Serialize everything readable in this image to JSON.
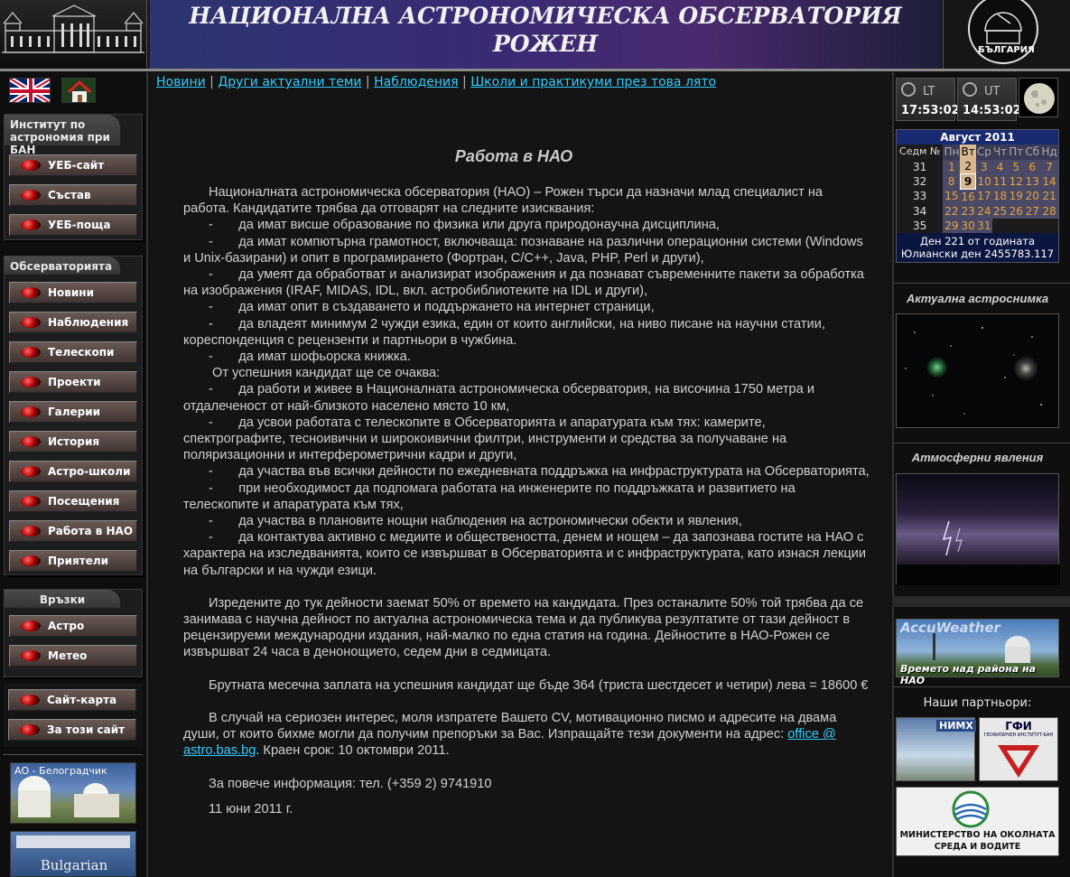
{
  "header": {
    "title_line1": "НАЦИОНАЛНА АСТРОНОМИЧЕСКА ОБСЕРВАТОРИЯ",
    "title_line2": "РОЖЕН",
    "logo_text": "БЪЛГАРИЯ"
  },
  "left": {
    "institute_title": "Институт по астрономия при БАН",
    "institute_items": [
      "УЕБ-сайт",
      "Състав",
      "УЕБ-поща"
    ],
    "observatory_title": "Обсерваторията",
    "observatory_items": [
      "Новини",
      "Наблюдения",
      "Телескопи",
      "Проекти",
      "Галерии",
      "История",
      "Астро-школи",
      "Посещения",
      "Работа в НАО",
      "Приятели"
    ],
    "links_title": "Връзки",
    "links_items": [
      "Астро",
      "Метео"
    ],
    "extra_items": [
      "Сайт-карта",
      "За този сайт"
    ],
    "thumb1_caption": "АО - Белоградчик",
    "thumb2_caption": "Bulgarian"
  },
  "topnav": {
    "items": [
      "Новини",
      "Други актуални теми",
      "Наблюдения",
      "Школи и практикуми през това лято"
    ],
    "separator": " | "
  },
  "content": {
    "title": "Работа в НАО",
    "p1": "Националната астрономическа обсерватория (НАО) – Рожен търси да назначи млад специалист на работа.  Кандидатите трябва да отговарят на следните изисквания:",
    "req": [
      "да имат висше образование по физика или друга природонаучна дисциплина,",
      "да имат компютърна грамотност, включваща: познаване на различни операционни системи (Windows и Unix-базирани) и опит в програмирането (Фортран, C/C++, Java, PHP, Perl и други),",
      "да умеят да обработват и анализират изображения и да познават съвременните пакети за обработка на изображения (IRAF, MIDAS, IDL, вкл. астробиблиотеките на IDL и други),",
      "да имат опит в създаването и  поддържането на интернет страници,",
      "да владеят минимум 2 чужди езика, един от които английски, на ниво писане на научни статии, кореспонденция с рецензенти и партньори в чужбина.",
      "да имат шофьорска книжка."
    ],
    "expect_intro": "От успешния кандидат ще се очаква:",
    "exp": [
      "да работи и живее в Националната астрономическа обсерватория, на височина 1750 метра и отдалеченост от най-близкото населено място 10 км,",
      "да усвои работата с телескопите в Обсерваторията и апаратурата към тях: камерите, спектрографите, тесноивични и широкоивични филтри, инструменти и средства за получаване на поляризационни и интерферометрични кадри и други,",
      "да участва във всички дейности по ежедневната поддръжка на инфраструктурата на Обсерваторията,",
      "при необходимост да подпомага работата на инженерите по поддръжката и развитието на телескопите и апаратурата към тях,",
      "да участва в плановите нощни наблюдения на астрономически обекти и явления,",
      "да контактува активно с медиите и обществеността, денем и нощем – да запознава гостите на НАО с характера на изследванията, които се извършват в Обсерваторията и с инфраструктурата, като изнася лекции на български и на чужди езици."
    ],
    "p_work": "Изредените до тук дейности заемат 50% от времето на кандидата. През останалите 50% той трябва да се занимава с научна дейност по актуална астрономическа тема и да публикува резултатите от тази дейност в рецензируеми международни издания, най-малко по една статия на година. Дейностите в НАО-Рожен се извършват 24 часа в денонощието, седем дни в седмицата.",
    "p_salary": "Брутната месечна заплата на успешния кандидат ще бъде 364 (триста шестдесет и четири) лева = 18600 €",
    "p_apply_1": "В случай на сериозен интерес, моля изпратете Вашето CV, мотивационно писмо и адресите на двама души, от които бихме могли да получим препоръки за Вас. Изпращайте тези документи на адрес:",
    "email": "office @ astro.bas.bg",
    "p_apply_2": ". Краен срок: 10 октомври 2011.",
    "p_info": "За повече информация: тел. (+359 2) 9741910",
    "date": "11 юни 2011 г.",
    "bullet": "-"
  },
  "right": {
    "lt_label": "LT",
    "lt_time": "17:53:02",
    "ut_label": "UT",
    "ut_time": "14:53:02",
    "calendar": {
      "month": "Август 2011",
      "week_label": "Седм №",
      "days": [
        "Пн",
        "Вт",
        "Ср",
        "Чт",
        "Пт",
        "Сб",
        "Нд"
      ],
      "weeks": [
        {
          "wk": "31",
          "d": [
            "1",
            "2",
            "3",
            "4",
            "5",
            "6",
            "7"
          ]
        },
        {
          "wk": "32",
          "d": [
            "8",
            "9",
            "10",
            "11",
            "12",
            "13",
            "14"
          ]
        },
        {
          "wk": "33",
          "d": [
            "15",
            "16",
            "17",
            "18",
            "19",
            "20",
            "21"
          ]
        },
        {
          "wk": "34",
          "d": [
            "22",
            "23",
            "24",
            "25",
            "26",
            "27",
            "28"
          ]
        },
        {
          "wk": "35",
          "d": [
            "29",
            "30",
            "31",
            "",
            "",
            "",
            ""
          ]
        }
      ],
      "today": "9",
      "foot1": "Ден 221 от годината",
      "foot2": "Юлиански ден 2455783.117"
    },
    "astro_title": "Актуална астроснимка",
    "atmo_title": "Атмосферни явления",
    "weather_brand": "AccuWeather",
    "weather_caption": "Времето над района на НАО",
    "partners_title": "Наши партньори:",
    "partner1": "НИМХ",
    "partner2": "ГФИ",
    "partner2_sub": "ГЕОФИЗИЧЕН ИНСТИТУТ-БАН",
    "partner3_line1": "МИНИСТЕРСТВО НА ОКОЛНАТА",
    "partner3_line2": "СРЕДА И ВОДИТЕ"
  }
}
